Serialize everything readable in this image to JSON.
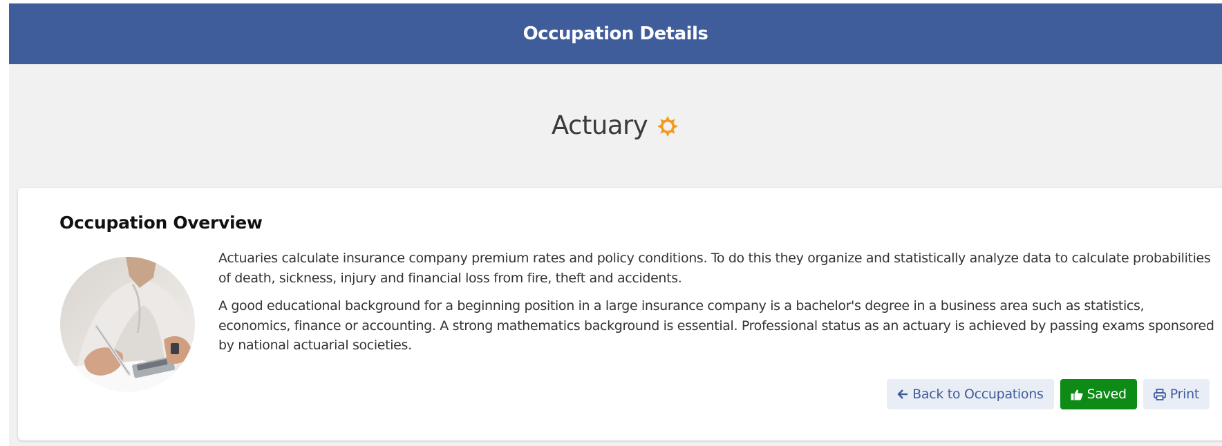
{
  "header": {
    "title": "Occupation Details",
    "background": "#3f5c9b"
  },
  "occupation": {
    "name": "Actuary",
    "icon": "sun-icon",
    "icon_color": "#f39a1e"
  },
  "overview": {
    "title": "Occupation Overview",
    "image": "person-writing-with-calculator-photo",
    "paragraphs": [
      "Actuaries calculate insurance company premium rates and policy conditions. To do this they organize and statistically analyze data to calculate probabilities of death, sickness, injury and financial loss from fire, theft and accidents.",
      "A good educational background for a beginning position in a large insurance company is a bachelor's degree in a business area such as statistics, economics, finance or accounting. A strong mathematics background is essential. Professional status as an actuary is achieved by passing exams sponsored by national actuarial societies."
    ]
  },
  "actions": {
    "back_label": "Back to Occupations",
    "back_icon": "arrow-left-icon",
    "saved_label": "Saved",
    "saved_icon": "thumbs-up-icon",
    "saved_color": "#0e8a17",
    "print_label": "Print",
    "print_icon": "printer-icon"
  }
}
